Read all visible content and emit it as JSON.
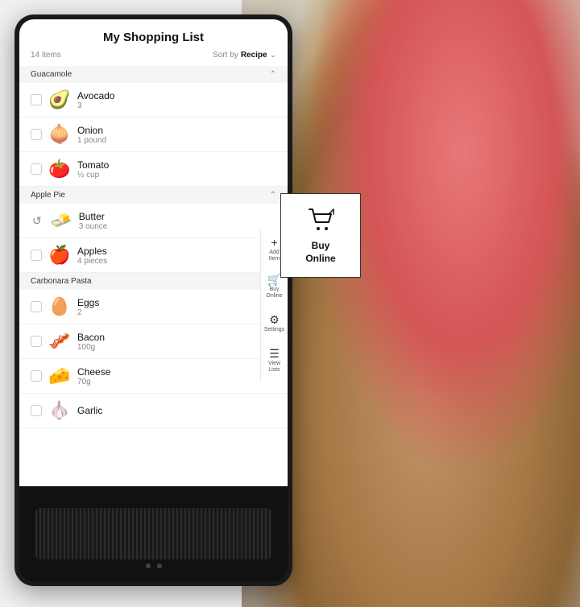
{
  "app": {
    "title": "My Shopping List",
    "item_count": "14 items",
    "sort_by_label": "Sort by",
    "sort_by_value": "Recipe",
    "chevron": "›"
  },
  "sidebar_actions": [
    {
      "icon": "+",
      "label": "Add Item"
    },
    {
      "icon": "🛒",
      "label": "Buy Online"
    },
    {
      "icon": "⚙",
      "label": "Settings"
    },
    {
      "icon": "☰",
      "label": "View Lists"
    }
  ],
  "sections": [
    {
      "name": "Guacamole",
      "collapsed": false,
      "items": [
        {
          "name": "Avocado",
          "qty": "3",
          "emoji": "🥑",
          "checked": false
        },
        {
          "name": "Onion",
          "qty": "1 pound",
          "emoji": "🧅",
          "checked": false,
          "undo": false
        },
        {
          "name": "Tomato",
          "qty": "½ cup",
          "emoji": "🍅",
          "checked": false
        }
      ]
    },
    {
      "name": "Apple Pie",
      "collapsed": false,
      "items": [
        {
          "name": "Butter",
          "qty": "3 ounce",
          "emoji": "🧈",
          "checked": false,
          "undo": true
        },
        {
          "name": "Apples",
          "qty": "4 pieces",
          "emoji": "🍎",
          "checked": false
        }
      ]
    },
    {
      "name": "Carbonara Pasta",
      "collapsed": false,
      "items": [
        {
          "name": "Eggs",
          "qty": "2",
          "emoji": "🥚",
          "checked": false
        },
        {
          "name": "Bacon",
          "qty": "100g",
          "emoji": "🥓",
          "checked": false
        },
        {
          "name": "Cheese",
          "qty": "70g",
          "emoji": "🧀",
          "checked": false
        },
        {
          "name": "Garlic",
          "qty": "",
          "emoji": "🧄",
          "checked": false
        }
      ]
    }
  ],
  "buy_online": {
    "label": "Buy\nOnline"
  }
}
